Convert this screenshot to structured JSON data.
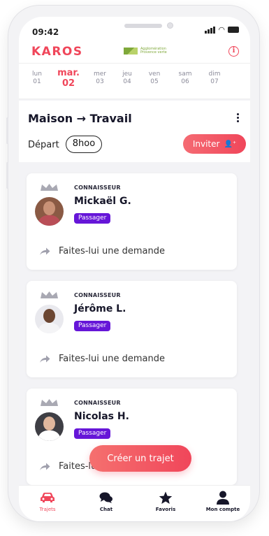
{
  "status_bar": {
    "time": "09:42"
  },
  "header": {
    "logo": "KAROS",
    "partner_text": "Agglomération Provence verte",
    "info_icon": "info-circle-icon"
  },
  "dates": [
    {
      "name": "lun",
      "num": "01",
      "active": false
    },
    {
      "name": "mar.",
      "num": "02",
      "active": true
    },
    {
      "name": "mer",
      "num": "03",
      "active": false
    },
    {
      "name": "jeu",
      "num": "04",
      "active": false
    },
    {
      "name": "ven",
      "num": "05",
      "active": false
    },
    {
      "name": "sam",
      "num": "06",
      "active": false
    },
    {
      "name": "dim",
      "num": "07",
      "active": false
    }
  ],
  "route": {
    "title": "Maison → Travail",
    "depart_label": "Départ",
    "depart_time": "8hoo",
    "invite_label": "Inviter"
  },
  "cards": [
    {
      "badge": "CONNAISSEUR",
      "name": "Mickaël G.",
      "role": "Passager",
      "action": "Faites-lui une demande"
    },
    {
      "badge": "CONNAISSEUR",
      "name": "Jérôme L.",
      "role": "Passager",
      "action": "Faites-lui une demande"
    },
    {
      "badge": "CONNAISSEUR",
      "name": "Nicolas H.",
      "role": "Passager",
      "action": "Faites-lui une demande"
    }
  ],
  "fab": {
    "label": "Créer un trajet"
  },
  "tabs": [
    {
      "label": "Trajets",
      "icon": "car-icon",
      "active": true
    },
    {
      "label": "Chat",
      "icon": "chat-bubbles-icon",
      "active": false
    },
    {
      "label": "Favoris",
      "icon": "star-icon",
      "active": false
    },
    {
      "label": "Mon compte",
      "icon": "user-icon",
      "active": false
    }
  ],
  "colors": {
    "brand": "#f0465a",
    "passenger_pill": "#6616d8",
    "text_dark": "#161629"
  }
}
